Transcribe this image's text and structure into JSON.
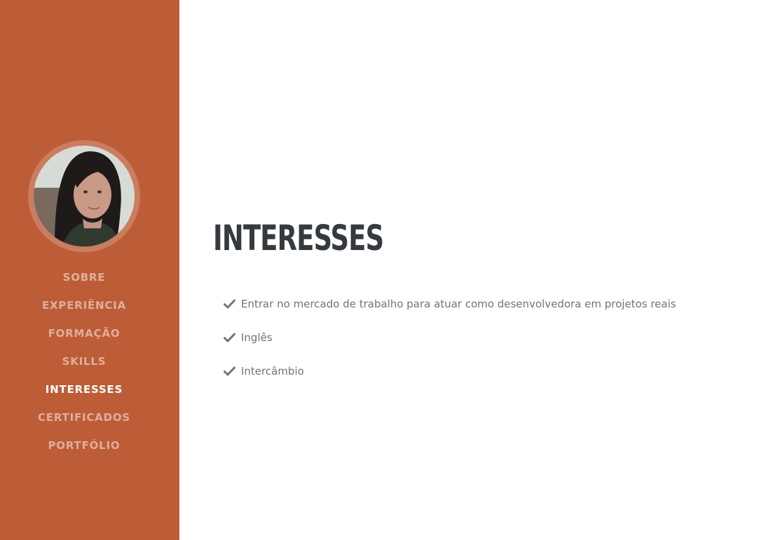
{
  "sidebar": {
    "avatar_alt": "profile-photo",
    "nav": [
      {
        "label": "SOBRE",
        "active": false
      },
      {
        "label": "EXPERIÊNCIA",
        "active": false
      },
      {
        "label": "FORMAÇÃO",
        "active": false
      },
      {
        "label": "SKILLS",
        "active": false
      },
      {
        "label": "INTERESSES",
        "active": true
      },
      {
        "label": "CERTIFICADOS",
        "active": false
      },
      {
        "label": "PORTFÓLIO",
        "active": false
      }
    ]
  },
  "main": {
    "title": "INTERESSES",
    "items": [
      {
        "icon": "check-icon",
        "text": "Entrar no mercado de trabalho para atuar como desenvolvedora em projetos reais"
      },
      {
        "icon": "check-icon",
        "text": "Inglês"
      },
      {
        "icon": "check-icon",
        "text": "Intercâmbio"
      }
    ]
  },
  "colors": {
    "sidebar_bg": "#bd5d38",
    "title": "#343a40",
    "text": "#6c757d",
    "nav_inactive": "rgba(255,255,255,0.5)",
    "nav_active": "#ffffff"
  }
}
